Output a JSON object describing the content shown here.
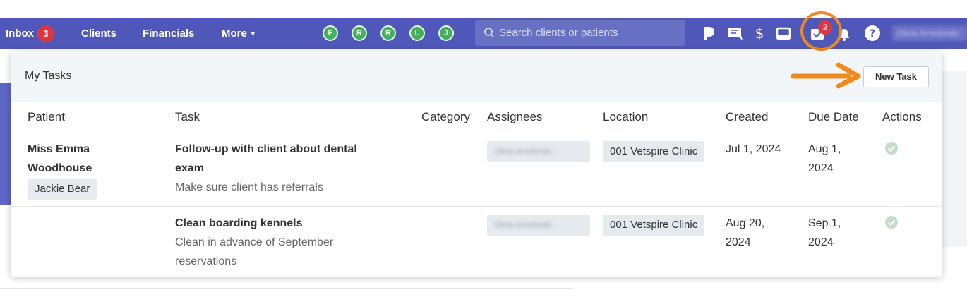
{
  "nav": {
    "inbox_label": "Inbox",
    "inbox_count": "3",
    "clients_label": "Clients",
    "financials_label": "Financials",
    "more_label": "More",
    "locations": [
      "F",
      "R",
      "R",
      "L",
      "J"
    ],
    "search_placeholder": "Search clients or patients",
    "tasks_count": "2",
    "user_name": "Olivia Arredondo"
  },
  "panel": {
    "title": "My Tasks",
    "new_task_label": "New Task",
    "columns": {
      "patient": "Patient",
      "task": "Task",
      "category": "Category",
      "assignees": "Assignees",
      "location": "Location",
      "created": "Created",
      "due_date": "Due Date",
      "actions": "Actions"
    },
    "rows": [
      {
        "patient_line1": "Miss Emma",
        "patient_line2": "Woodhouse",
        "pet": "Jackie Bear",
        "task_line1": "Follow-up with client about dental",
        "task_line2": "exam",
        "task_desc": "Make sure client has referrals",
        "assignee": "Olivia Arredondo",
        "location": "001 Vetspire Clinic",
        "created": "Jul 1, 2024",
        "due_line1": "Aug 1,",
        "due_line2": "2024"
      },
      {
        "task_line1": "Clean boarding kennels",
        "task_desc_line1": "Clean in advance of September",
        "task_desc_line2": "reservations",
        "assignee": "Olivia Arredondo",
        "location": "001 Vetspire Clinic",
        "created_line1": "Aug 20,",
        "created_line2": "2024",
        "due_line1": "Sep 1,",
        "due_line2": "2024"
      }
    ]
  },
  "colors": {
    "nav_bg": "#4f58b8",
    "badge_red": "#e03443",
    "location_green": "#43b05c",
    "highlight_orange": "#f08a1c",
    "check_green": "#c6dccb"
  }
}
